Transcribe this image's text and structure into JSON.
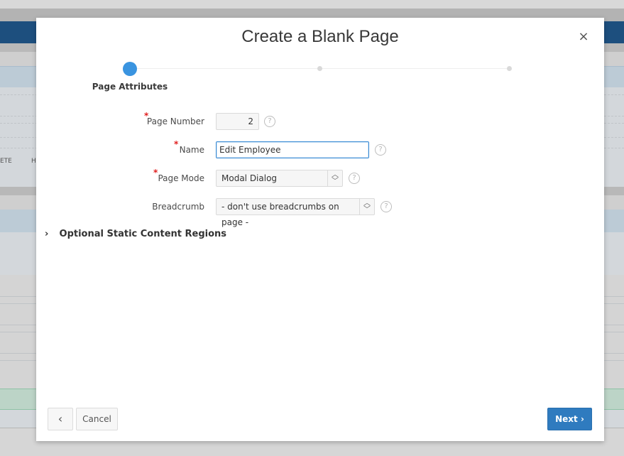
{
  "background": {
    "partial_button_1": "ETE",
    "partial_button_2": "H"
  },
  "dialog": {
    "title": "Create a Blank Page",
    "close_icon": "×",
    "wizard": {
      "steps": [
        {
          "label": "Page Attributes",
          "state": "active"
        },
        {
          "label": "",
          "state": "pending"
        },
        {
          "label": "",
          "state": "pending"
        }
      ],
      "active_color": "#3a94e0"
    },
    "form": {
      "page_number": {
        "label": "Page Number",
        "required": true,
        "value": "2"
      },
      "name": {
        "label": "Name",
        "required": true,
        "value": "Edit Employee"
      },
      "page_mode": {
        "label": "Page Mode",
        "required": true,
        "value": "Modal Dialog"
      },
      "breadcrumb": {
        "label": "Breadcrumb",
        "required": false,
        "value": "- don't use breadcrumbs on page -"
      },
      "required_marker": "*",
      "help_glyph": "?"
    },
    "optional_section": {
      "label": "Optional Static Content Regions",
      "expanded": false,
      "chevron": "›"
    },
    "footer": {
      "back_glyph": "‹",
      "cancel_label": "Cancel",
      "next_label": "Next",
      "next_glyph": "›",
      "next_color": "#2f7bbf"
    }
  }
}
